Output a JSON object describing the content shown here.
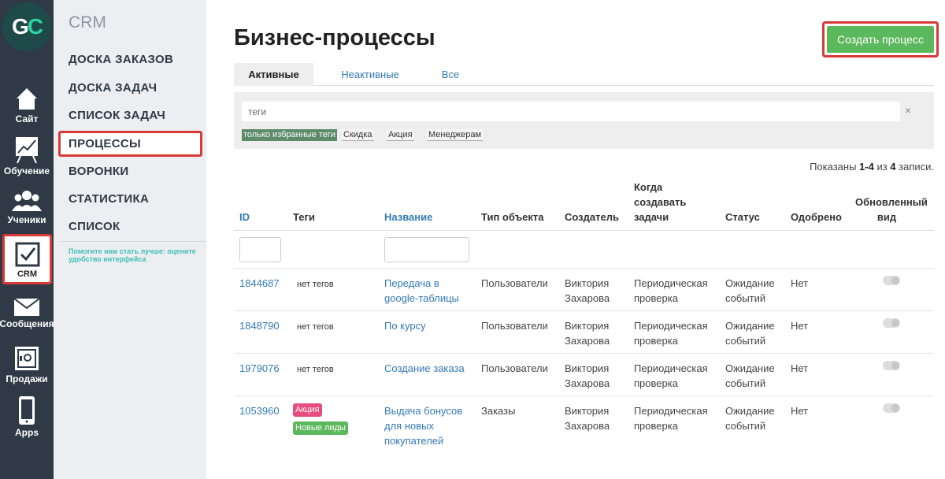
{
  "logo": {
    "text_g": "G",
    "text_c": "C"
  },
  "rail": [
    {
      "label": "Сайт",
      "icon": "house-icon"
    },
    {
      "label": "Обучение",
      "icon": "chart-board-icon"
    },
    {
      "label": "Ученики",
      "icon": "users-icon"
    },
    {
      "label": "CRM",
      "icon": "checkbox-icon"
    },
    {
      "label": "Сообщения",
      "icon": "envelope-icon"
    },
    {
      "label": "Продажи",
      "icon": "safe-icon"
    },
    {
      "label": "Apps",
      "icon": "phone-icon"
    }
  ],
  "menu": {
    "title": "CRM",
    "items": [
      "ДОСКА ЗАКАЗОВ",
      "ДОСКА ЗАДАЧ",
      "СПИСОК ЗАДАЧ",
      "ПРОЦЕССЫ",
      "ВОРОНКИ",
      "СТАТИСТИКА",
      "СПИСОК"
    ],
    "help": "Помогите нам стать лучше: оцените удобство интерфейса"
  },
  "page": {
    "title": "Бизнес-процессы",
    "create_label": "Создать процесс"
  },
  "tabs": [
    "Активные",
    "Неактивные",
    "Все"
  ],
  "filter": {
    "placeholder": "теги",
    "clear": "×",
    "chips": [
      "только избранные теги",
      "Скидка",
      "Акция",
      "Менеджерам"
    ]
  },
  "summary": {
    "prefix": "Показаны ",
    "range": "1-4",
    "middle": " из ",
    "total": "4",
    "suffix": " записи."
  },
  "columns": {
    "id": "ID",
    "tags": "Теги",
    "name": "Название",
    "object_type": "Тип объекта",
    "creator": "Создатель",
    "when_l1": "Когда",
    "when_l2": "создавать",
    "when_l3": "задачи",
    "status": "Статус",
    "approved": "Одобрено",
    "updated_l1": "Обновленный",
    "updated_l2": "вид"
  },
  "rows": [
    {
      "id": "1844687",
      "tags_text": "нет тегов",
      "name_l1": "Передача в",
      "name_l2": "google-таблицы",
      "name_l3": "",
      "type": "Пользователи",
      "creator_l1": "Виктория",
      "creator_l2": "Захарова",
      "when_l1": "Периодическая",
      "when_l2": "проверка",
      "status_l1": "Ожидание",
      "status_l2": "событий",
      "approved": "Нет",
      "updated": false
    },
    {
      "id": "1848790",
      "tags_text": "нет тегов",
      "name_l1": "По курсу",
      "name_l2": "",
      "name_l3": "",
      "type": "Пользователи",
      "creator_l1": "Виктория",
      "creator_l2": "Захарова",
      "when_l1": "Периодическая",
      "when_l2": "проверка",
      "status_l1": "Ожидание",
      "status_l2": "событий",
      "approved": "Нет",
      "updated": false
    },
    {
      "id": "1979076",
      "tags_text": "нет тегов",
      "name_l1": "Создание заказа",
      "name_l2": "",
      "name_l3": "",
      "type": "Пользователи",
      "creator_l1": "Виктория",
      "creator_l2": "Захарова",
      "when_l1": "Периодическая",
      "when_l2": "проверка",
      "status_l1": "Ожидание",
      "status_l2": "событий",
      "approved": "Нет",
      "updated": false
    },
    {
      "id": "1053960",
      "tag1": "Акция",
      "tag2": "Новые лиды",
      "name_l1": "Выдача бонусов",
      "name_l2": "для новых",
      "name_l3": "покупателей",
      "type": "Заказы",
      "creator_l1": "Виктория",
      "creator_l2": "Захарова",
      "when_l1": "Периодическая",
      "when_l2": "проверка",
      "status_l1": "Ожидание",
      "status_l2": "событий",
      "approved": "Нет",
      "updated": false
    }
  ],
  "colors": {
    "accent": "#337ab7",
    "create_button": "#5cb85c",
    "highlight": "#d93a36",
    "rail": "#2f3a46",
    "badge_pink": "#e74c7c",
    "badge_green": "#5cb85c"
  }
}
